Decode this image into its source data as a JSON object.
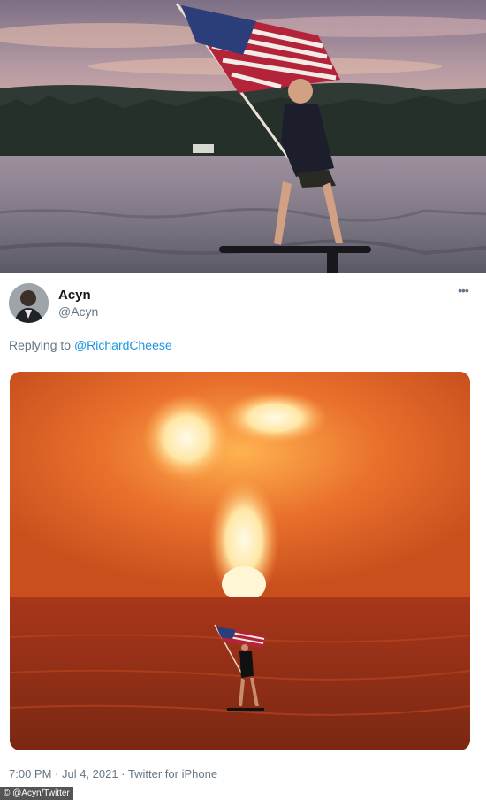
{
  "tweet": {
    "display_name": "Acyn",
    "handle": "@Acyn",
    "more_icon": "more-dots-icon",
    "more_label": "•••",
    "reply_prefix": "Replying to ",
    "reply_to": "@RichardCheese",
    "timestamp": "7:00 PM · Jul 4, 2021",
    "separator": " · ",
    "source": "Twitter for iPhone"
  },
  "credit": "© @Acyn/Twitter",
  "colors": {
    "handle_gray": "#657786",
    "link_blue": "#1b95e0",
    "fire_orange": "#e0692a"
  }
}
